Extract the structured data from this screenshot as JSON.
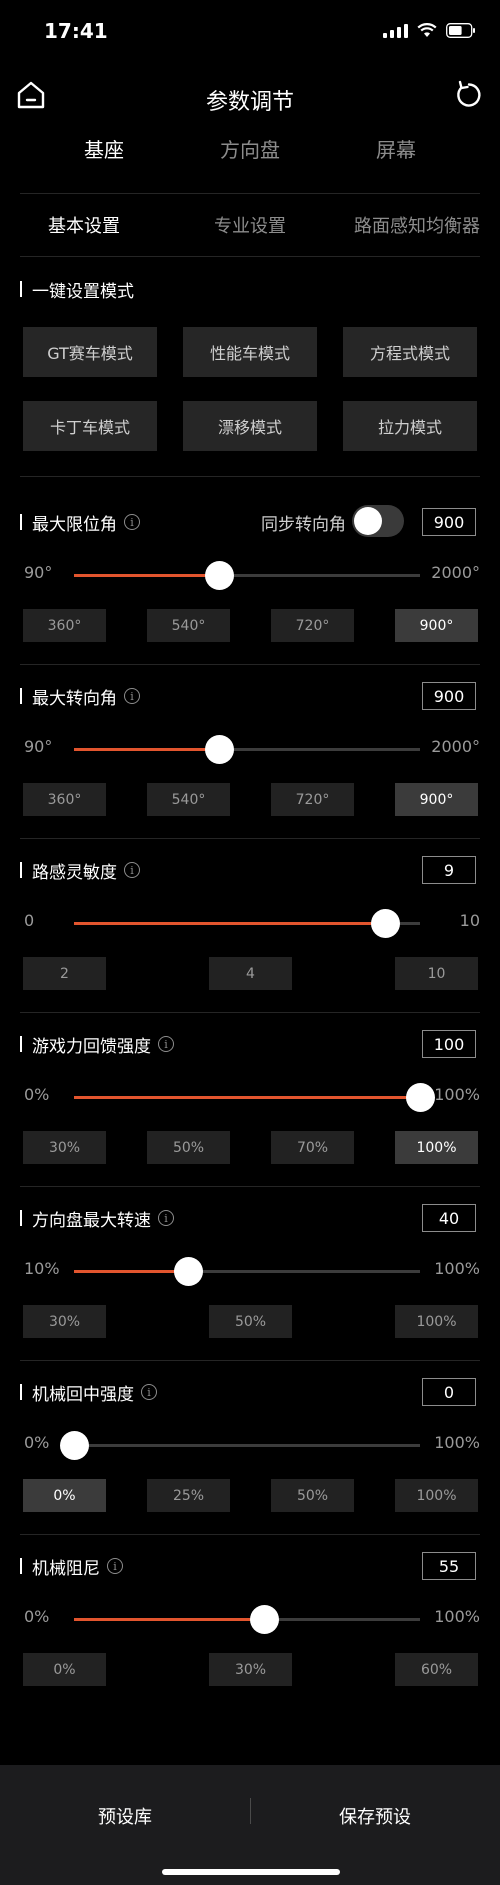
{
  "status": {
    "time": "17:41",
    "battery_level": 0.6
  },
  "header": {
    "title": "参数调节"
  },
  "top_tabs": [
    "基座",
    "方向盘",
    "屏幕"
  ],
  "sub_tabs": [
    "基本设置",
    "专业设置",
    "路面感知均衡器"
  ],
  "one_key": {
    "title": "一键设置模式",
    "modes": [
      "GT赛车模式",
      "性能车模式",
      "方程式模式",
      "卡丁车模式",
      "漂移模式",
      "拉力模式"
    ]
  },
  "sync_label": "同步转向角",
  "sync_enabled": false,
  "sections": [
    {
      "title": "最大限位角",
      "value": "900",
      "min": "90°",
      "max": "2000°",
      "fraction": 0.42,
      "presets": [
        "360°",
        "540°",
        "720°",
        "900°"
      ],
      "active": 3
    },
    {
      "title": "最大转向角",
      "value": "900",
      "min": "90°",
      "max": "2000°",
      "fraction": 0.42,
      "presets": [
        "360°",
        "540°",
        "720°",
        "900°"
      ],
      "active": 3
    },
    {
      "title": "路感灵敏度",
      "value": "9",
      "min": "0",
      "max": "10",
      "fraction": 0.9,
      "presets": [
        "2",
        "4",
        "10"
      ],
      "active": -1
    },
    {
      "title": "游戏力回馈强度",
      "value": "100",
      "min": "0%",
      "max": "100%",
      "fraction": 1.0,
      "presets": [
        "30%",
        "50%",
        "70%",
        "100%"
      ],
      "active": 3
    },
    {
      "title": "方向盘最大转速",
      "value": "40",
      "min": "10%",
      "max": "100%",
      "fraction": 0.33,
      "presets": [
        "30%",
        "50%",
        "100%"
      ],
      "active": -1
    },
    {
      "title": "机械回中强度",
      "value": "0",
      "min": "0%",
      "max": "100%",
      "fraction": 0.0,
      "presets": [
        "0%",
        "25%",
        "50%",
        "100%"
      ],
      "active": 0
    },
    {
      "title": "机械阻尼",
      "value": "55",
      "min": "0%",
      "max": "100%",
      "fraction": 0.55,
      "presets": [
        "0%",
        "30%",
        "60%"
      ],
      "active": -1
    }
  ],
  "bottom": {
    "left": "预设库",
    "right": "保存预设"
  },
  "colors": {
    "accent": "#e2552e",
    "background": "#000000",
    "button": "#262626"
  }
}
